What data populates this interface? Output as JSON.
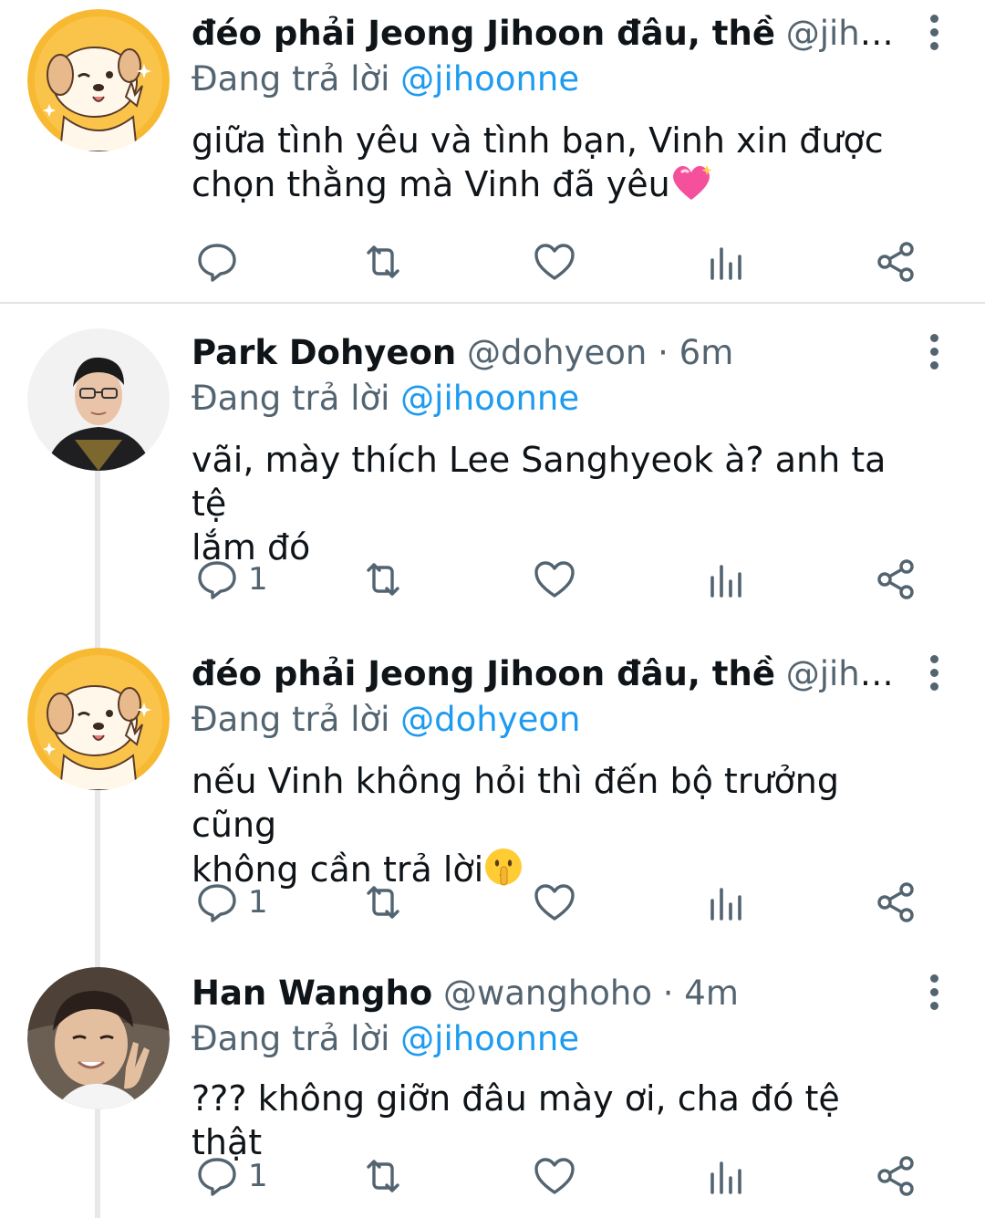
{
  "tweets": [
    {
      "name": "đéo phải Jeong Jihoon đâu, thề",
      "meta": "@jihoo…",
      "reply_prefix": "Đang trả lời",
      "reply_handle": "@jihoonne",
      "body_line1": "giữa tình yêu và tình bạn, Vinh xin được",
      "body_line2": "chọn thằng mà Vinh đã yêu",
      "body_emoji": "sparkling-heart-icon",
      "reply_count": "",
      "avatar": "dog-cartoon-avatar"
    },
    {
      "name": "Park Dohyeon",
      "meta": "@dohyeon · 6m",
      "reply_prefix": "Đang trả lời",
      "reply_handle": "@jihoonne",
      "body_line1": "vãi, mày thích Lee Sanghyeok à? anh ta tệ",
      "body_line2": "lắm đó",
      "reply_count": "1",
      "avatar": "person-photo-avatar"
    },
    {
      "name": "đéo phải Jeong Jihoon đâu, thề",
      "meta": "@jihoo…",
      "reply_prefix": "Đang trả lời",
      "reply_handle": "@dohyeon",
      "body_line1": "nếu Vinh không hỏi thì đến bộ trưởng cũng",
      "body_line2": "không cần trả lời",
      "body_emoji": "shushing-face-icon",
      "reply_count": "1",
      "avatar": "dog-cartoon-avatar"
    },
    {
      "name": "Han Wangho",
      "meta": "@wanghoho · 4m",
      "reply_prefix": "Đang trả lời",
      "reply_handle": "@jihoonne",
      "body_line1": "??? không giỡn đâu mày ơi, cha đó tệ thật",
      "body_line2": "",
      "reply_count": "1",
      "avatar": "person-photo-avatar"
    }
  ],
  "colors": {
    "text": "#0f1419",
    "secondary": "#536471",
    "link": "#1d9bf0",
    "separator": "#e1e5e8",
    "dog_avatar_bg": "#f7b932"
  }
}
